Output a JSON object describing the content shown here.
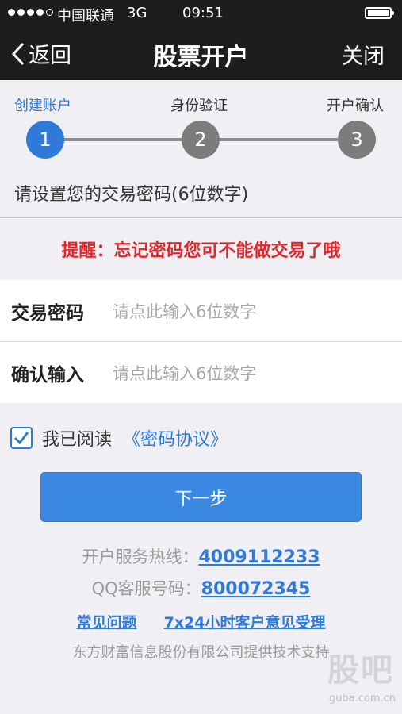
{
  "status_bar": {
    "carrier": "中国联通",
    "network": "3G",
    "time": "09:51"
  },
  "nav": {
    "back_label": "返回",
    "title": "股票开户",
    "close_label": "关闭"
  },
  "steps": [
    {
      "number": "1",
      "label": "创建账户",
      "active": true
    },
    {
      "number": "2",
      "label": "身份验证",
      "active": false
    },
    {
      "number": "3",
      "label": "开户确认",
      "active": false
    }
  ],
  "instruction": "请设置您的交易密码(6位数字)",
  "reminder": "提醒：忘记密码您可不能做交易了哦",
  "form": {
    "password_label": "交易密码",
    "password_placeholder": "请点此输入6位数字",
    "confirm_label": "确认输入",
    "confirm_placeholder": "请点此输入6位数字"
  },
  "agreement": {
    "checked": true,
    "text": "我已阅读",
    "link": "《密码协议》"
  },
  "next_button": "下一步",
  "hotline": {
    "label": "开户服务热线：",
    "number": "4009112233"
  },
  "qq": {
    "label": "QQ客服号码：",
    "number": "800072345"
  },
  "links": {
    "faq": "常见问题",
    "feedback": "7x24小时客户意见受理"
  },
  "footer": "东方财富信息股份有限公司提供技术支持",
  "watermark": {
    "main": "股吧",
    "sub": "guba.com.cn"
  },
  "colors": {
    "accent": "#2f7ad8",
    "warning": "#e0272b",
    "navbar": "#1d1d1d"
  }
}
